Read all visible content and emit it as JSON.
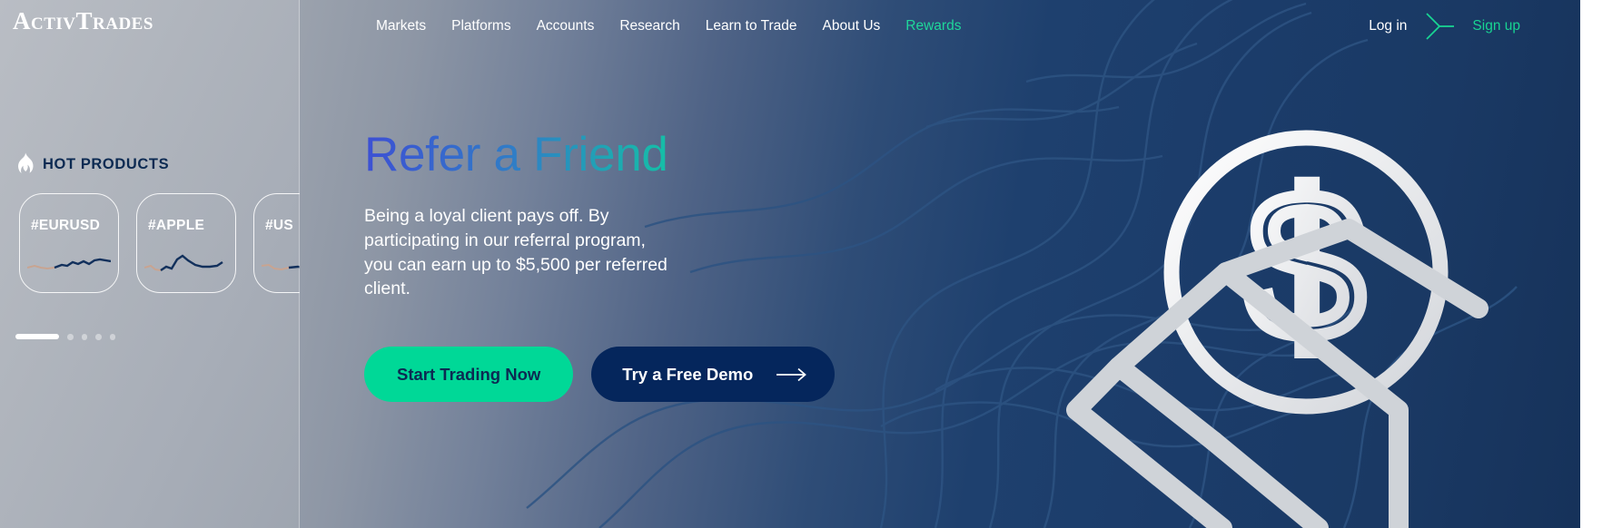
{
  "brand": {
    "logo_text": "ActivTrades",
    "logo_icon": "activtrades-wordmark"
  },
  "colors": {
    "accent_green": "#18d492",
    "button_green": "#00d897",
    "navy": "#05265c",
    "heading_gradient_start": "#3d4fd4",
    "heading_gradient_mid": "#16bba9",
    "heading_gradient_end": "#08d88a",
    "sidebar_gray": "#b0b5bd",
    "hero_navy": "#16325a",
    "title_dark": "#0c2a52"
  },
  "nav": {
    "items": [
      {
        "label": "Markets",
        "accent": false
      },
      {
        "label": "Platforms",
        "accent": false
      },
      {
        "label": "Accounts",
        "accent": false
      },
      {
        "label": "Research",
        "accent": false
      },
      {
        "label": "Learn to Trade",
        "accent": false
      },
      {
        "label": "About Us",
        "accent": false
      },
      {
        "label": "Rewards",
        "accent": true
      }
    ],
    "login_label": "Log in",
    "signup_label": "Sign up",
    "divider_icon": "chevron-right-divider-icon"
  },
  "sidebar": {
    "section_title": "HOT PRODUCTS",
    "flame_icon": "flame-icon",
    "cards": [
      {
        "ticker": "#EURUSD",
        "sparkline_icon": "sparkline-chart-icon"
      },
      {
        "ticker": "#APPLE",
        "sparkline_icon": "sparkline-chart-icon"
      },
      {
        "ticker": "#US",
        "sparkline_icon": "sparkline-chart-icon"
      }
    ],
    "carousel": {
      "active_index": 0,
      "total": 5
    }
  },
  "hero": {
    "title": "Refer a Friend",
    "body": "Being a loyal client pays off. By participating in our referral program, you can earn up to $5,500 per referred client.",
    "primary_button": "Start Trading Now",
    "secondary_button": "Try a Free Demo",
    "secondary_button_icon": "arrow-right-icon",
    "illustration": "dollar-coin-in-hand-illustration"
  }
}
